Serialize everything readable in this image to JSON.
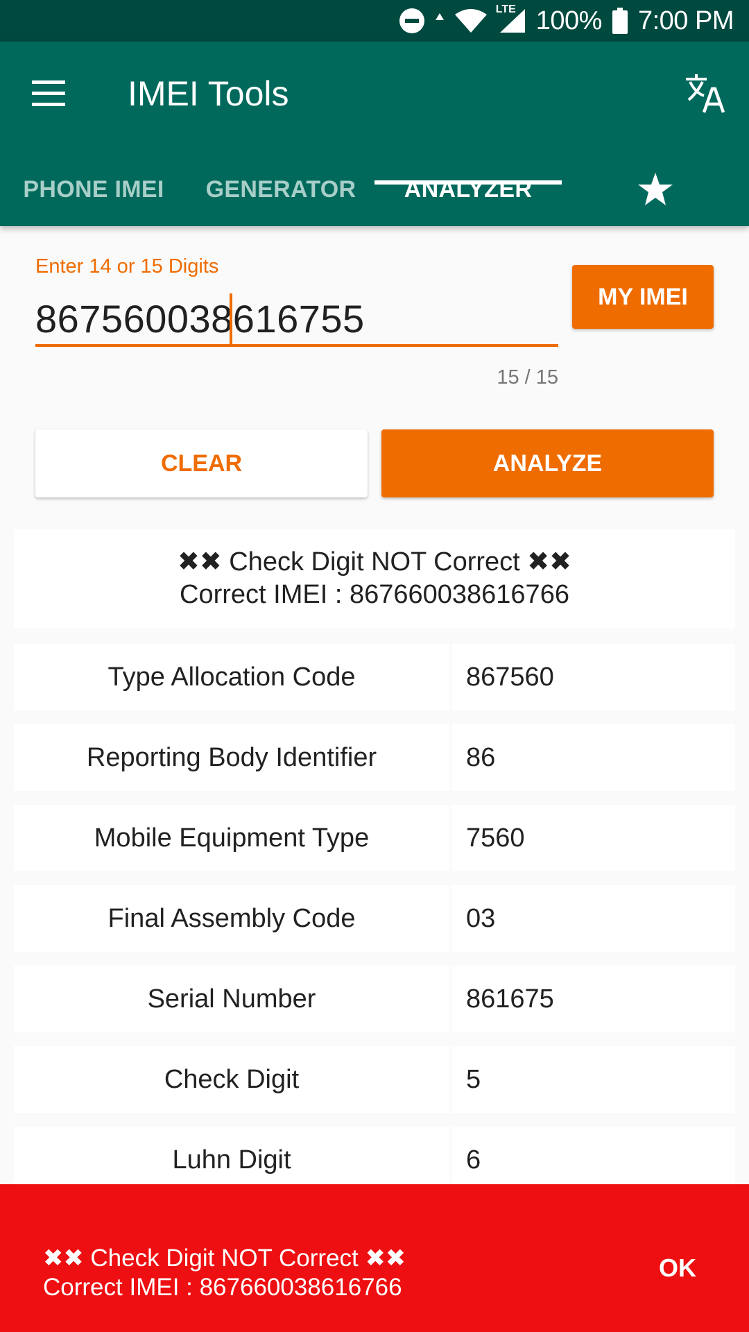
{
  "status_bar": {
    "icons": [
      "do-not-disturb-icon",
      "data-arrow-icon",
      "wifi-icon",
      "lte-icon",
      "signal-icon",
      "battery-icon"
    ],
    "lte_label": "LTE",
    "battery": "100%",
    "time": "7:00 PM"
  },
  "app_bar": {
    "title": "IMEI Tools",
    "menu_icon": "hamburger-menu-icon",
    "translate_icon": "translate-icon"
  },
  "tabs": [
    {
      "label": "PHONE IMEI",
      "active": false
    },
    {
      "label": "GENERATOR",
      "active": false
    },
    {
      "label": "ANALYZER",
      "active": true
    },
    {
      "label": "",
      "icon": "star-icon",
      "active": false
    }
  ],
  "form": {
    "label": "Enter 14 or 15 Digits",
    "imei_value": "867560038616755",
    "counter": "15 / 15",
    "my_imei_label": "MY IMEI",
    "clear_label": "CLEAR",
    "analyze_label": "ANALYZE"
  },
  "result": {
    "line1": "✖✖ Check Digit NOT Correct ✖✖",
    "line2": "Correct IMEI : 867660038616766"
  },
  "table": [
    {
      "label": "Type Allocation Code",
      "value": "867560"
    },
    {
      "label": "Reporting Body Identifier",
      "value": "86"
    },
    {
      "label": "Mobile Equipment Type",
      "value": "7560"
    },
    {
      "label": "Final Assembly Code",
      "value": "03"
    },
    {
      "label": "Serial Number",
      "value": "861675"
    },
    {
      "label": "Check Digit",
      "value": "5"
    },
    {
      "label": "Luhn Digit",
      "value": "6"
    }
  ],
  "snackbar": {
    "line1": "✖✖ Check Digit NOT Correct ✖✖",
    "line2": "Correct IMEI : 867660038616766",
    "action": "OK"
  },
  "colors": {
    "status_bar": "#00493f",
    "primary": "#00695c",
    "accent": "#ef6c00",
    "error": "#ed0f11"
  }
}
